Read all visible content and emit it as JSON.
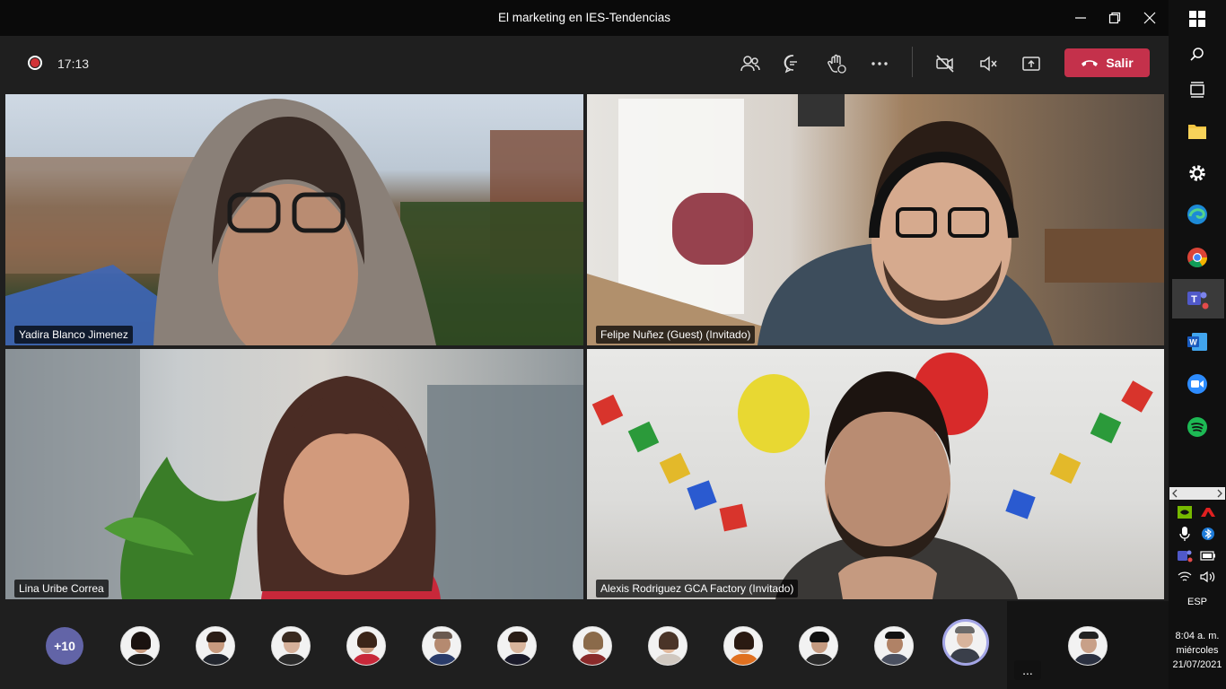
{
  "window": {
    "title": "El marketing en IES-Tendencias"
  },
  "toolbar": {
    "timer": "17:13",
    "leave_label": "Salir"
  },
  "participants": [
    {
      "name": "Yadira Blanco Jimenez"
    },
    {
      "name": "Felipe Nuñez (Guest) (Invitado)"
    },
    {
      "name": "Lina Uribe Correa"
    },
    {
      "name": "Alexis Rodriguez GCA Factory (Invitado)"
    }
  ],
  "roster": {
    "more_count": "+10",
    "ellipsis": "..."
  },
  "taskbar": {
    "language": "ESP",
    "time": "8:04 a. m.",
    "day": "miércoles",
    "date": "21/07/2021"
  },
  "colors": {
    "leave_button": "#c4314b",
    "recording": "#d13438",
    "roster_more": "#6264a7",
    "active_ring": "#a3a5e6"
  }
}
